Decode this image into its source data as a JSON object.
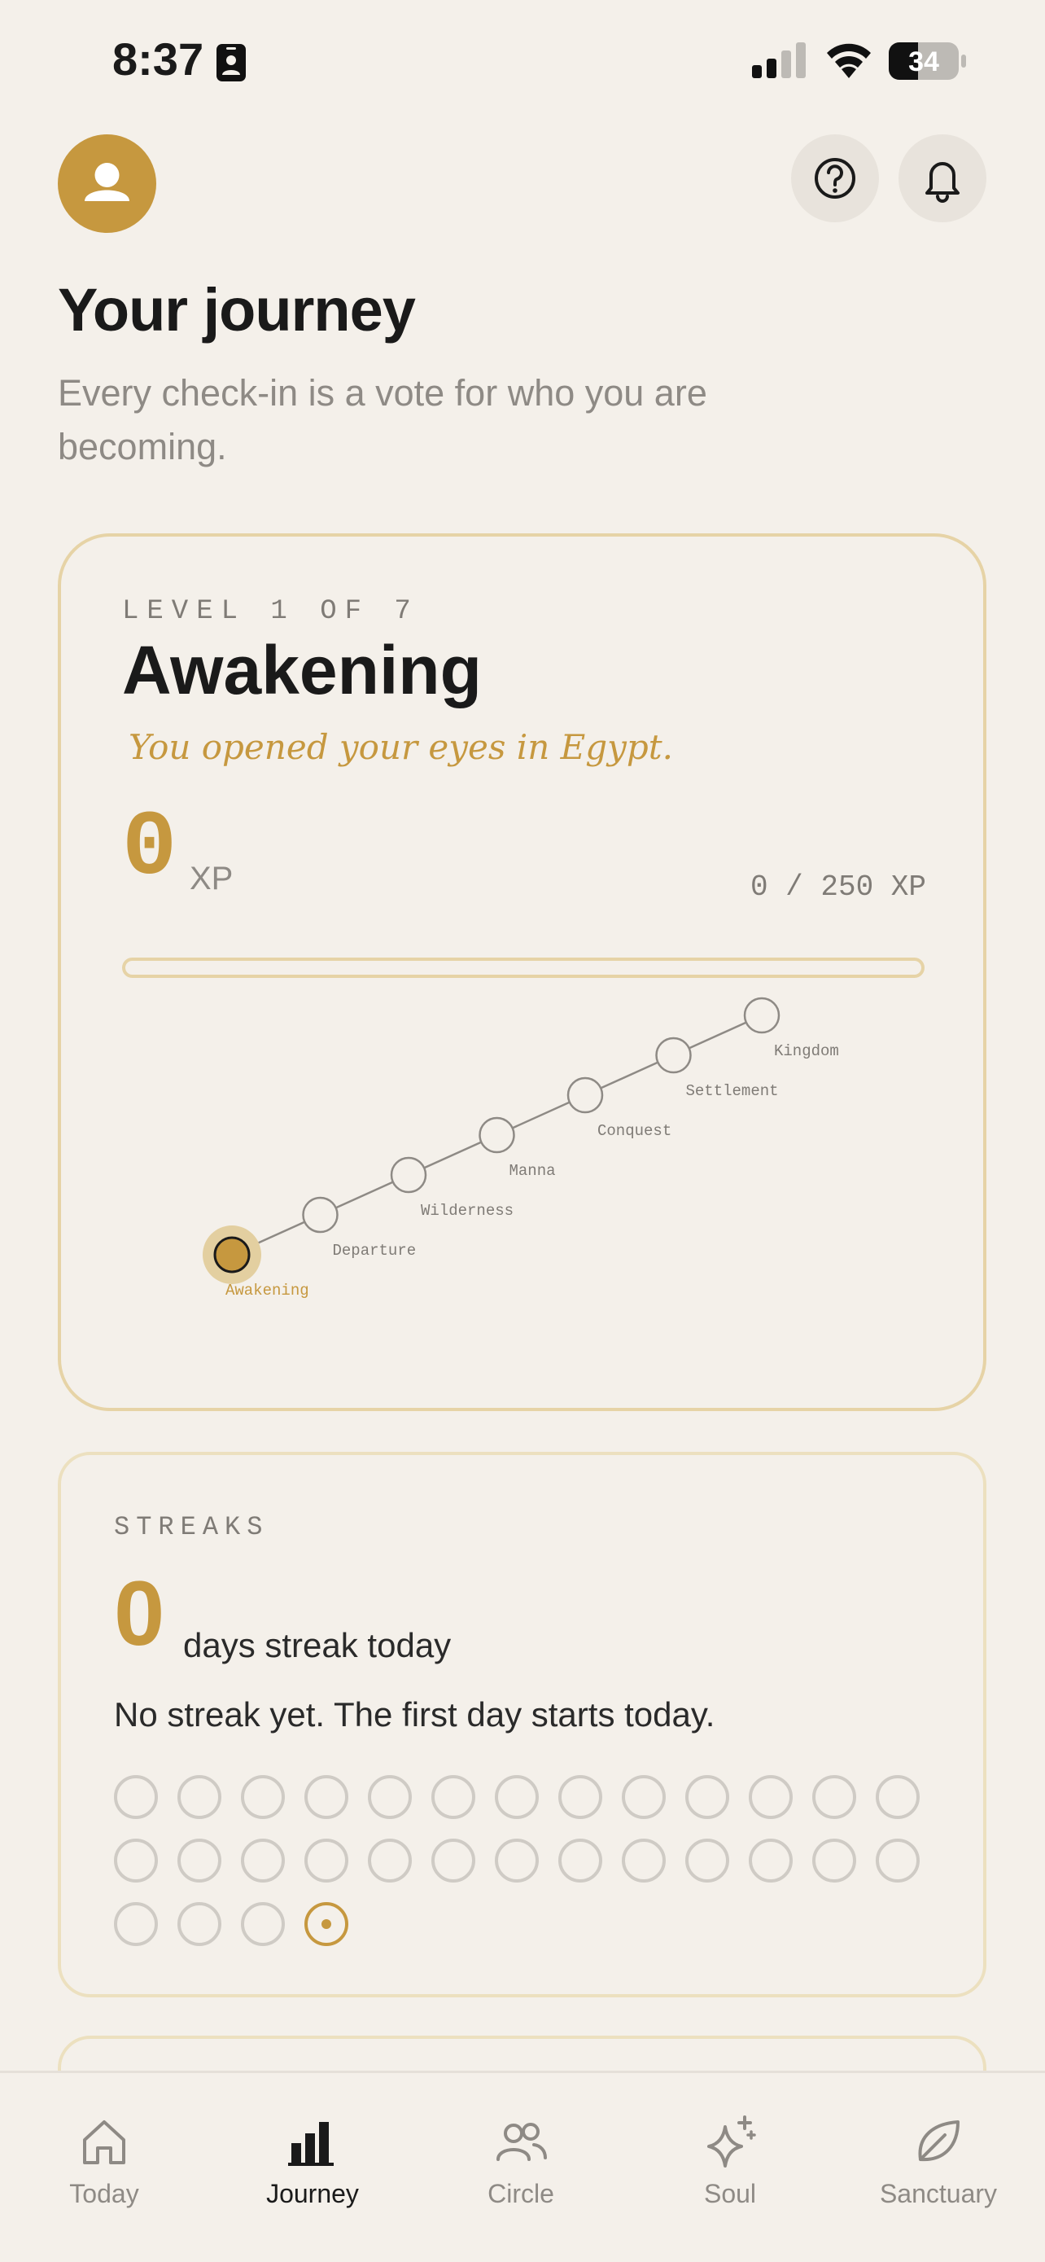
{
  "status_bar": {
    "time": "8:37",
    "battery": "34"
  },
  "header": {
    "title": "Your journey",
    "subtitle": "Every check-in is a vote for who you are becoming."
  },
  "level_card": {
    "kicker": "LEVEL 1 OF 7",
    "name": "Awakening",
    "tagline": "You opened your eyes in Egypt.",
    "xp_value": "0",
    "xp_unit": "XP",
    "xp_progress_text": "0 / 250 XP",
    "xp_fraction": 0,
    "stages": [
      {
        "label": "Awakening",
        "current": true
      },
      {
        "label": "Departure",
        "current": false
      },
      {
        "label": "Wilderness",
        "current": false
      },
      {
        "label": "Manna",
        "current": false
      },
      {
        "label": "Conquest",
        "current": false
      },
      {
        "label": "Settlement",
        "current": false
      },
      {
        "label": "Kingdom",
        "current": false
      }
    ]
  },
  "streak_card": {
    "kicker": "STREAKS",
    "count": "0",
    "unit": "days streak today",
    "message": "No streak yet. The first day starts today.",
    "days_total": 30,
    "today_index": 29
  },
  "tabs": [
    {
      "label": "Today",
      "icon": "home-icon",
      "active": false
    },
    {
      "label": "Journey",
      "icon": "bar-chart-icon",
      "active": true
    },
    {
      "label": "Circle",
      "icon": "people-icon",
      "active": false
    },
    {
      "label": "Soul",
      "icon": "sparkle-icon",
      "active": false
    },
    {
      "label": "Sanctuary",
      "icon": "leaf-icon",
      "active": false
    }
  ],
  "colors": {
    "accent": "#c6983f",
    "background": "#f4f0ea",
    "border": "#e6d3a6",
    "muted": "#8e8a85"
  }
}
